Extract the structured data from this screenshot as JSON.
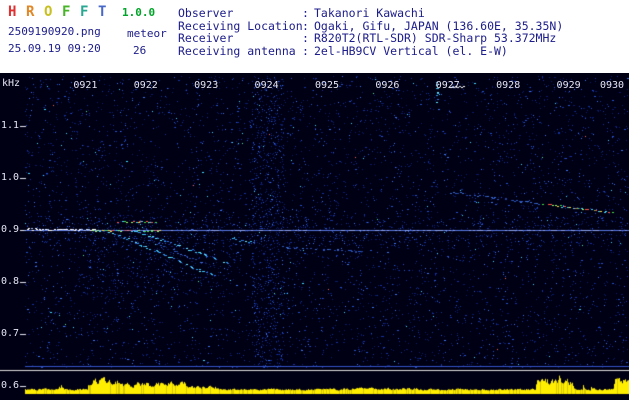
{
  "header": {
    "title_letters": [
      {
        "char": "H",
        "color": "#e03030"
      },
      {
        "char": "R",
        "color": "#e08828"
      },
      {
        "char": "O",
        "color": "#c8c020"
      },
      {
        "char": "F",
        "color": "#48b428"
      },
      {
        "char": "F",
        "color": "#28a890"
      },
      {
        "char": "T",
        "color": "#4868c8"
      }
    ],
    "version": {
      "text": "1.0.0",
      "color": "#00a428"
    },
    "filename": "2509190920.png",
    "mode_label": "meteor",
    "datetime": "25.09.19 09:20",
    "echo_count": "26",
    "info_rows": [
      {
        "label": "Observer",
        "value": "Takanori Kawachi"
      },
      {
        "label": "Receiving Location",
        "value": "Ogaki, Gifu, JAPAN (136.60E, 35.35N)"
      },
      {
        "label": "Receiver",
        "value": "R820T2(RTL-SDR) SDR-Sharp 53.372MHz"
      },
      {
        "label": "Receiving antenna",
        "value": "2el-HB9CV Vertical (el. E-W)"
      }
    ],
    "text_color": "#1c1c8a",
    "bg_color": "#ffffff"
  },
  "spectrogram": {
    "freq_unit_label": "kHz",
    "y_tick_labels": [
      "1.1",
      "1.0",
      "0.9",
      "0.8",
      "0.7",
      "0.6"
    ],
    "x_tick_labels": [
      "0921",
      "0922",
      "0923",
      "0924",
      "0925",
      "0926",
      "0927",
      "0928",
      "0929",
      "0930"
    ]
  },
  "chart_data": {
    "type": "heatmap",
    "title": "HROFFT meteor-echo spectrogram 09:20-09:30 with signal-level strip",
    "x_axis": {
      "unit": "HHMM",
      "range": [
        "0920",
        "0930"
      ],
      "ticks": [
        "0921",
        "0922",
        "0923",
        "0924",
        "0925",
        "0926",
        "0927",
        "0928",
        "0929",
        "0930"
      ]
    },
    "y_axis": {
      "unit": "kHz",
      "ticks": [
        1.1,
        1.0,
        0.9,
        0.8,
        0.7,
        0.6
      ],
      "range_khz": [
        0.63,
        1.2
      ]
    },
    "carrier_line_khz": 0.9,
    "echo_count": 26,
    "colors": {
      "bg": "#000014",
      "noise": [
        "#0b1d6a",
        "#16329e",
        "#2750cc",
        "#3f74f0",
        "#45d9ff"
      ],
      "carrier": "#5a78e6",
      "carrier_sparkle": "#8da4f0",
      "band_edge_line": "#3454c8",
      "threshold_line": "#dcdcdc",
      "level_bar": "#ffee00",
      "level_bar_dim": "#d8c800",
      "label": "#e4e4f4"
    },
    "themes": {
      "cyan": [
        "#38c8ff",
        "#2e96e6",
        "#64e4ff",
        "#2f6fe0"
      ],
      "dim": [
        "#2a55c0",
        "#3a6ad0",
        "#24429e"
      ],
      "mixed": [
        "#44e044",
        "#ffd832",
        "#ff5546",
        "#44d4ff",
        "#9cff6e"
      ],
      "white": [
        "#dce6ff",
        "#ffffff",
        "#aac4ff"
      ]
    },
    "traces": [
      {
        "name": "carrier-bright-head",
        "theme": "white",
        "points_min_khz": [
          [
            0.0,
            0.901
          ],
          [
            1.15,
            0.9
          ]
        ]
      },
      {
        "name": "carrier-sparkle",
        "theme": "mixed",
        "points_min_khz": [
          [
            1.13,
            0.898
          ],
          [
            2.24,
            0.898
          ]
        ]
      },
      {
        "name": "echo-horizontal-1",
        "theme": "mixed",
        "points_min_khz": [
          [
            1.54,
            0.915
          ],
          [
            2.2,
            0.915
          ]
        ]
      },
      {
        "name": "aircraft-diagonal-1",
        "theme": "cyan",
        "points_min_khz": [
          [
            1.29,
            0.902
          ],
          [
            3.15,
            0.81
          ]
        ]
      },
      {
        "name": "aircraft-diagonal-2",
        "theme": "cyan",
        "points_min_khz": [
          [
            1.87,
            0.896
          ],
          [
            3.36,
            0.837
          ]
        ]
      },
      {
        "name": "aircraft-diagonal-3",
        "theme": "dim",
        "points_min_khz": [
          [
            2.04,
            0.881
          ],
          [
            2.9,
            0.838
          ]
        ]
      },
      {
        "name": "echo-dash-1",
        "theme": "cyan",
        "points_min_khz": [
          [
            3.39,
            0.883
          ],
          [
            3.77,
            0.875
          ]
        ]
      },
      {
        "name": "faint-horizontal-1",
        "theme": "dim",
        "points_min_khz": [
          [
            4.25,
            0.867
          ],
          [
            5.05,
            0.862
          ]
        ]
      },
      {
        "name": "faint-horizontal-2",
        "theme": "dim",
        "points_min_khz": [
          [
            5.13,
            0.862
          ],
          [
            5.58,
            0.858
          ]
        ]
      },
      {
        "name": "aircraft-diagonal-4a",
        "theme": "dim",
        "points_min_khz": [
          [
            7.0,
            0.973
          ],
          [
            8.53,
            0.95
          ]
        ]
      },
      {
        "name": "aircraft-diagonal-4b",
        "theme": "mixed",
        "points_min_khz": [
          [
            8.53,
            0.95
          ],
          [
            9.72,
            0.933
          ]
        ]
      },
      {
        "name": "head-echo-vertical",
        "theme": "cyan",
        "points_min_khz": [
          [
            6.82,
            1.185
          ],
          [
            6.82,
            1.144
          ]
        ]
      },
      {
        "name": "top-edge-dash",
        "theme": "white",
        "points_min_khz": [
          [
            7.04,
            1.175
          ],
          [
            7.25,
            1.175
          ]
        ]
      }
    ],
    "noise_bands_min": [
      [
        3.76,
        4.3
      ]
    ],
    "level_graph": {
      "unit": "relative signal level (px height), yellow bars vs time",
      "segments_min": [
        [
          0.0,
          1.04,
          3,
          6
        ],
        [
          1.04,
          1.6,
          8,
          18
        ],
        [
          1.6,
          2.65,
          5,
          14
        ],
        [
          2.65,
          3.15,
          4,
          9
        ],
        [
          3.15,
          5.05,
          3,
          6
        ],
        [
          5.05,
          6.55,
          3,
          7
        ],
        [
          6.55,
          8.45,
          3,
          6
        ],
        [
          8.45,
          9.06,
          6,
          18
        ],
        [
          9.06,
          9.75,
          3,
          6
        ],
        [
          9.75,
          10.0,
          8,
          20
        ]
      ]
    }
  }
}
